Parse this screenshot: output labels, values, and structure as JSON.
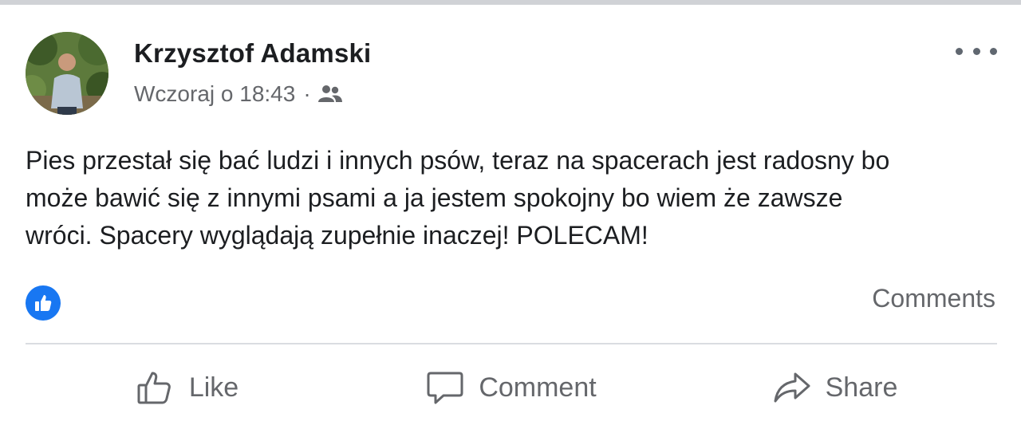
{
  "post": {
    "author": "Krzysztof Adamski",
    "timestamp": "Wczoraj o 18:43",
    "separator": "·",
    "audience_icon": "friends-icon",
    "text_lines": [
      "Pies przestał się bać ludzi i innych psów, teraz na spacerach jest radosny bo",
      "może bawić się z innymi psami a ja jestem spokojny bo wiem że zawsze",
      "wróci. Spacery wyglądają zupełnie inaczej! POLECAM!"
    ],
    "reaction_icon": "like-reaction-icon",
    "comments_label": "Comments"
  },
  "actions": {
    "like": "Like",
    "comment": "Comment",
    "share": "Share"
  },
  "colors": {
    "accent": "#1877f2",
    "secondary_text": "#65676b",
    "primary_text": "#1c1e21",
    "divider": "#dadde1"
  }
}
